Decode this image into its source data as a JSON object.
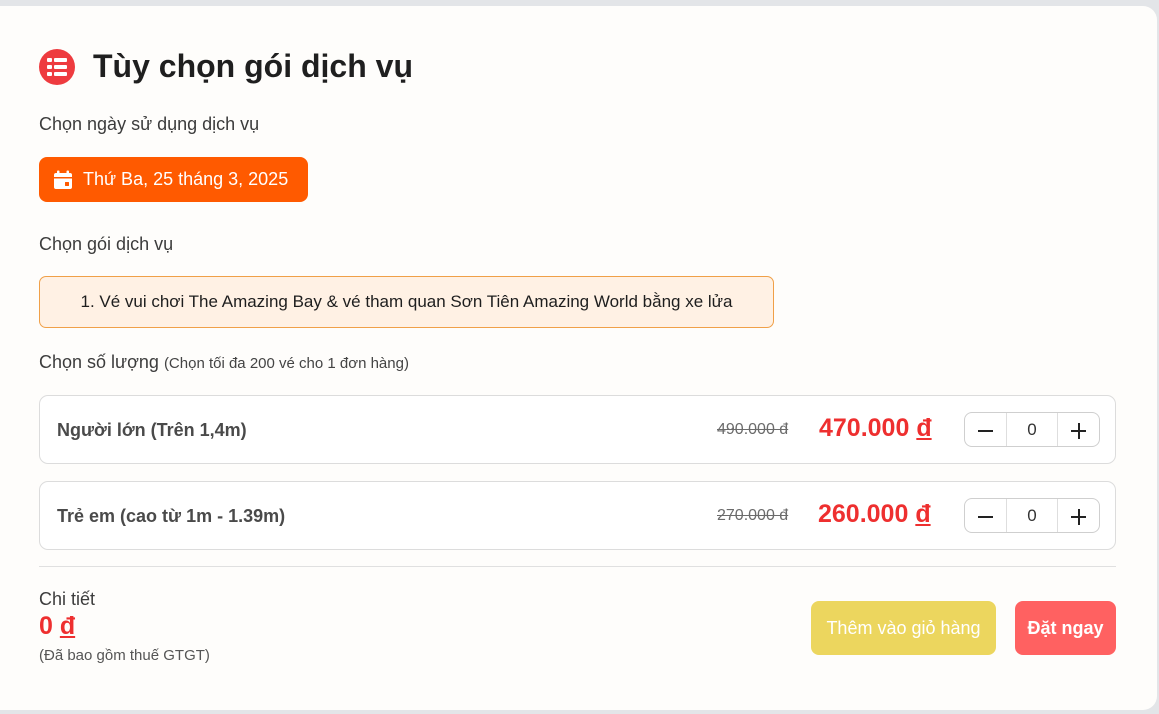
{
  "header": {
    "icon": "list-icon",
    "title": "Tùy chọn gói dịch vụ"
  },
  "date_section": {
    "label": "Chọn ngày sử dụng dịch vụ",
    "selected_date": "Thứ Ba, 25 tháng 3, 2025",
    "icon": "calendar-icon"
  },
  "package_section": {
    "label": "Chọn gói dịch vụ",
    "selected_package": "1. Vé vui chơi The Amazing Bay & vé tham quan Sơn Tiên Amazing World bằng xe lửa"
  },
  "quantity_section": {
    "label": "Chọn số lượng",
    "note": "(Chọn tối đa 200 vé cho 1 đơn hàng)",
    "tickets": [
      {
        "name": "Người lớn (Trên 1,4m)",
        "old_price": "490.000 đ",
        "new_price": "470.000",
        "currency": "đ",
        "quantity": "0"
      },
      {
        "name": "Trẻ em (cao từ 1m - 1.39m)",
        "old_price": "270.000 đ",
        "new_price": "260.000",
        "currency": "đ",
        "quantity": "0"
      }
    ]
  },
  "summary": {
    "label": "Chi tiết",
    "total": "0",
    "currency": "đ",
    "vat_note": "(Đã bao gồm thuế GTGT)",
    "add_to_cart": "Thêm vào giỏ hàng",
    "book_now": "Đặt ngay"
  },
  "colors": {
    "accent_orange": "#ff5a00",
    "price_red": "#ee2f2f",
    "cart_yellow": "#ecd65e",
    "buy_red": "#ff6161"
  }
}
